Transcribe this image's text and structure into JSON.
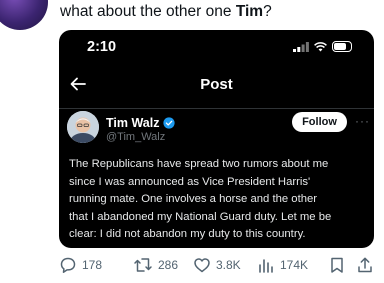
{
  "tweet": {
    "text_prefix": "what about the other one ",
    "text_bold": "Tim",
    "text_suffix": "?"
  },
  "screenshot": {
    "status_bar": {
      "time": "2:10"
    },
    "header": {
      "title": "Post"
    },
    "author": {
      "name": "Tim Walz",
      "handle": "@Tim_Walz",
      "verified": true
    },
    "follow_label": "Follow",
    "more_label": "···",
    "body_lines": [
      "The Republicans have spread two rumors about me",
      "since I was announced as Vice President Harris'",
      "running mate. One involves a horse and the other",
      "that I abandoned my National Guard duty. Let me be",
      "clear: I did not abandon my duty to this country."
    ]
  },
  "actions": {
    "replies": "178",
    "reposts": "286",
    "likes": "3.8K",
    "views": "174K"
  },
  "colors": {
    "verified_blue": "#1d9bf0",
    "dark_bg": "#000000",
    "action_gray": "#536471"
  }
}
